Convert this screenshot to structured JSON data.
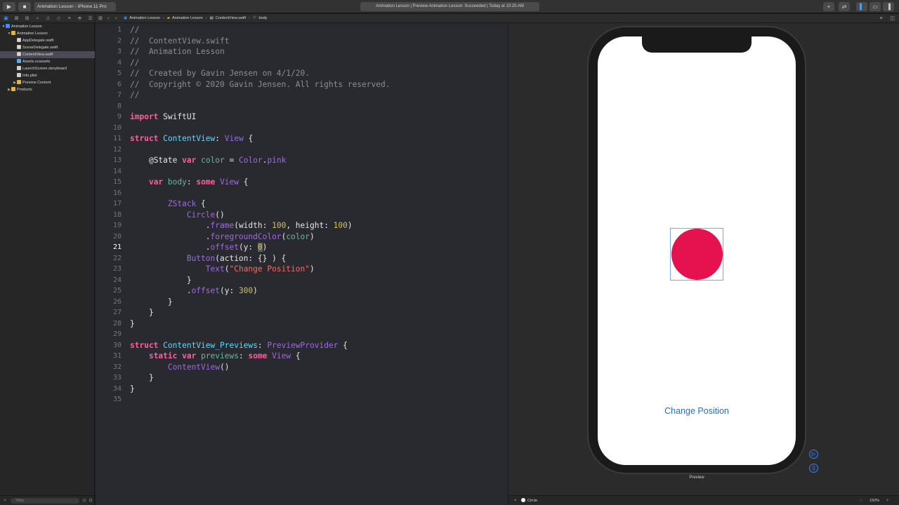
{
  "toolbar": {
    "scheme_target": "Animation Lesson",
    "scheme_device": "iPhone 11 Pro",
    "activity": "Animation Lesson | Preview Animation Lesson: Succeeded | Today at 10:25 AM"
  },
  "navigator": {
    "items": [
      {
        "label": "Animation Lesson",
        "level": 0,
        "kind": "proj",
        "tri": "▼"
      },
      {
        "label": "Animation Lesson",
        "level": 1,
        "kind": "folder",
        "tri": "▼"
      },
      {
        "label": "AppDelegate.swift",
        "level": 2,
        "kind": "swift",
        "tri": ""
      },
      {
        "label": "SceneDelegate.swift",
        "level": 2,
        "kind": "swift",
        "tri": ""
      },
      {
        "label": "ContentView.swift",
        "level": 2,
        "kind": "swift",
        "tri": "",
        "selected": true
      },
      {
        "label": "Assets.xcassets",
        "level": 2,
        "kind": "assets",
        "tri": ""
      },
      {
        "label": "LaunchScreen.storyboard",
        "level": 2,
        "kind": "doc",
        "tri": ""
      },
      {
        "label": "Info.plist",
        "level": 2,
        "kind": "doc",
        "tri": ""
      },
      {
        "label": "Preview Content",
        "level": 2,
        "kind": "folder",
        "tri": "▶"
      },
      {
        "label": "Products",
        "level": 1,
        "kind": "folder",
        "tri": "▶"
      }
    ],
    "filter_placeholder": "Filter"
  },
  "jumpbar": {
    "crumbs": [
      "Animation Lesson",
      "Animation Lesson",
      "ContentView.swift",
      "body"
    ]
  },
  "editor": {
    "current_line": 21,
    "lines": [
      "<span class=\"cm\">//</span>",
      "<span class=\"cm\">//  ContentView.swift</span>",
      "<span class=\"cm\">//  Animation Lesson</span>",
      "<span class=\"cm\">//</span>",
      "<span class=\"cm\">//  Created by Gavin Jensen on 4/1/20.</span>",
      "<span class=\"cm\">//  Copyright © 2020 Gavin Jensen. All rights reserved.</span>",
      "<span class=\"cm\">//</span>",
      "",
      "<span class=\"kw\">import</span> SwiftUI",
      "",
      "<span class=\"kw\">struct</span> <span class=\"ty\">ContentView</span>: <span class=\"pp\">View</span> {",
      "",
      "    <span class=\"attr\">@State</span> <span class=\"kw\">var</span> <span class=\"fn\">color</span> = <span class=\"pp\">Color</span>.<span class=\"pp\">pink</span>",
      "",
      "    <span class=\"kw\">var</span> <span class=\"fn\">body</span>: <span class=\"kw\">some</span> <span class=\"pp\">View</span> {",
      "",
      "        <span class=\"pp\">ZStack</span> {",
      "            <span class=\"pp\">Circle</span>()",
      "                .<span class=\"pp\">frame</span>(width: <span class=\"num\">100</span>, height: <span class=\"num\">100</span>)",
      "                .<span class=\"pp\">foregroundColor</span>(<span class=\"fn\">color</span>)",
      "                .<span class=\"pp\">offset</span>(y: <span class=\"num hl\">0</span>)",
      "            <span class=\"pp\">Button</span>(action: {} ) {",
      "                <span class=\"pp\">Text</span>(<span class=\"str\">\"Change Position\"</span>)",
      "            }",
      "            .<span class=\"pp\">offset</span>(y: <span class=\"num\">300</span>)",
      "        }",
      "    }",
      "}",
      "",
      "<span class=\"kw\">struct</span> <span class=\"ty\">ContentView_Previews</span>: <span class=\"pp\">PreviewProvider</span> {",
      "    <span class=\"kw\">static</span> <span class=\"kw\">var</span> <span class=\"fn\">previews</span>: <span class=\"kw\">some</span> <span class=\"pp\">View</span> {",
      "        <span class=\"pp\">ContentView</span>()",
      "    }",
      "}",
      ""
    ]
  },
  "preview": {
    "button_label": "Change Position",
    "label": "Preview",
    "circle_color": "#e6124f",
    "button_color": "#1f6fc5"
  },
  "canvasbar": {
    "selection": "Circle",
    "zoom": "150%"
  }
}
